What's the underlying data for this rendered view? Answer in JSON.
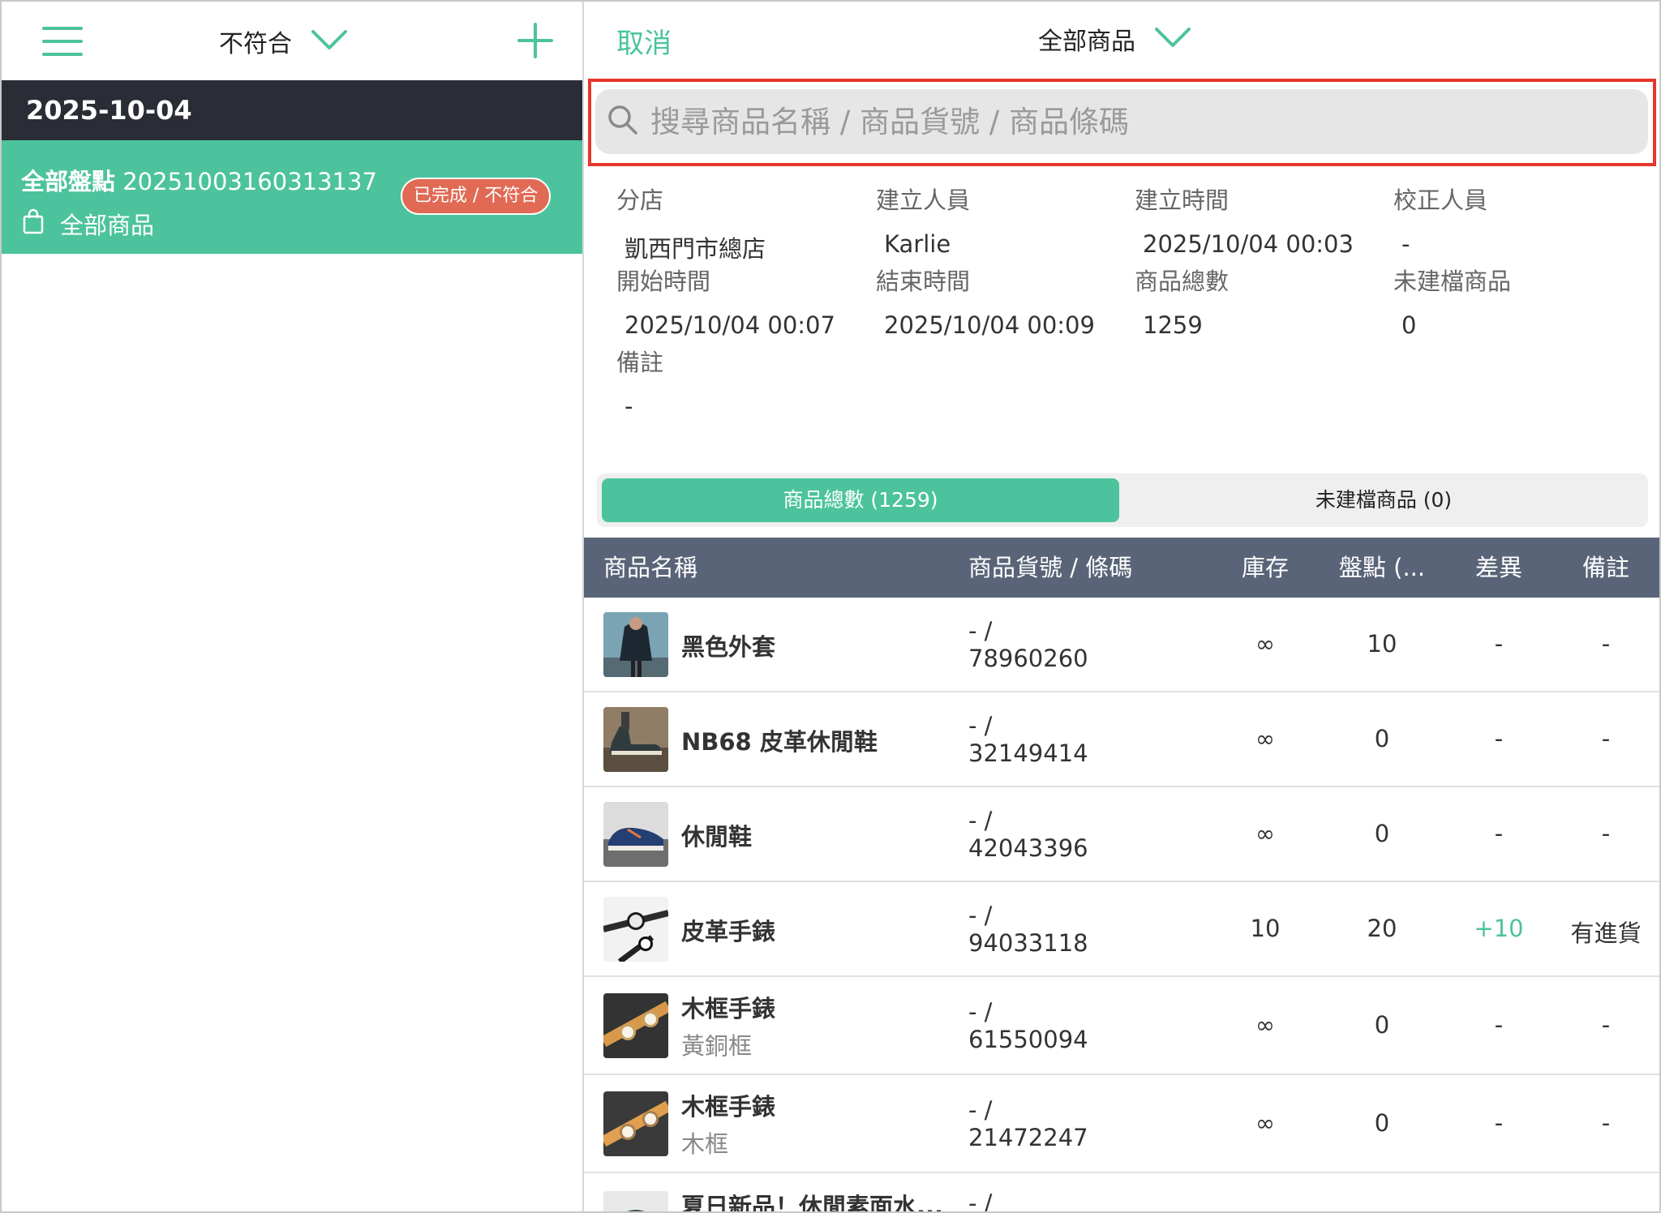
{
  "left": {
    "filter_label": "不符合",
    "date_header": "2025-10-04",
    "session": {
      "title_bold": "全部盤點",
      "title_id": "20251003160313137",
      "scope": "全部商品",
      "status": "已完成 / 不符合"
    }
  },
  "right": {
    "cancel_label": "取消",
    "product_filter_label": "全部商品",
    "search_placeholder": "搜尋商品名稱 / 商品貨號 / 商品條碼",
    "info": {
      "branch_label": "分店",
      "branch_value": "凱西門市總店",
      "creator_label": "建立人員",
      "creator_value": "Karlie",
      "created_label": "建立時間",
      "created_value": "2025/10/04 00:03",
      "corrector_label": "校正人員",
      "corrector_value": "-",
      "start_label": "開始時間",
      "start_value": "2025/10/04 00:07",
      "end_label": "結束時間",
      "end_value": "2025/10/04 00:09",
      "total_label": "商品總數",
      "total_value": "1259",
      "unfiled_label": "未建檔商品",
      "unfiled_value": "0",
      "note_label": "備註",
      "note_value": "-"
    },
    "tabs": {
      "total": "商品總數 (1259)",
      "unfiled": "未建檔商品 (0)"
    },
    "table": {
      "headers": {
        "name": "商品名稱",
        "code": "商品貨號 / 條碼",
        "stock": "庫存",
        "count": "盤點 (...",
        "diff": "差異",
        "note": "備註"
      },
      "rows": [
        {
          "name": "黑色外套",
          "variant": "",
          "code_top": "- /",
          "code_bottom": "78960260",
          "stock": "∞",
          "count": "10",
          "diff": "-",
          "note": "-"
        },
        {
          "name": "NB68 皮革休閒鞋",
          "variant": "",
          "code_top": "- /",
          "code_bottom": "32149414",
          "stock": "∞",
          "count": "0",
          "diff": "-",
          "note": "-"
        },
        {
          "name": "休閒鞋",
          "variant": "",
          "code_top": "- /",
          "code_bottom": "42043396",
          "stock": "∞",
          "count": "0",
          "diff": "-",
          "note": "-"
        },
        {
          "name": "皮革手錶",
          "variant": "",
          "code_top": "- /",
          "code_bottom": "94033118",
          "stock": "10",
          "count": "20",
          "diff": "+10",
          "note": "有進貨"
        },
        {
          "name": "木框手錶",
          "variant": "黃銅框",
          "code_top": "- /",
          "code_bottom": "61550094",
          "stock": "∞",
          "count": "0",
          "diff": "-",
          "note": "-"
        },
        {
          "name": "木框手錶",
          "variant": "木框",
          "code_top": "- /",
          "code_bottom": "21472247",
          "stock": "∞",
          "count": "0",
          "diff": "-",
          "note": "-"
        },
        {
          "name": "夏日新品！休閒素面水...",
          "variant": "",
          "code_top": "- /",
          "code_bottom": "",
          "stock": "",
          "count": "",
          "diff": "",
          "note": ""
        }
      ]
    }
  },
  "colors": {
    "accent": "#4cc39c",
    "dark_bar": "#2a2d36",
    "table_header": "#5a6478",
    "badge": "#e16a55",
    "highlight_outline": "#e6362a"
  }
}
